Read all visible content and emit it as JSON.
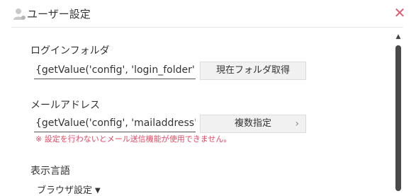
{
  "window": {
    "title": "ユーザー設定",
    "close_glyph": "✕",
    "title_icon": "user-settings-icon"
  },
  "login_folder": {
    "label": "ログインフォルダ",
    "value": "{getValue('config', 'login_folder'}",
    "button_label": "現在フォルダ取得"
  },
  "mail_address": {
    "label": "メールアドレス",
    "value": "{getValue('config', 'mailaddress'}",
    "button_label": "複数指定",
    "warning": "※ 設定を行わないとメール送信機能が使用できません。"
  },
  "language": {
    "label": "表示言語",
    "selected": "ブラウザ設定"
  },
  "colors": {
    "accent_red": "#e05a70",
    "warning_red": "#e04a64"
  }
}
